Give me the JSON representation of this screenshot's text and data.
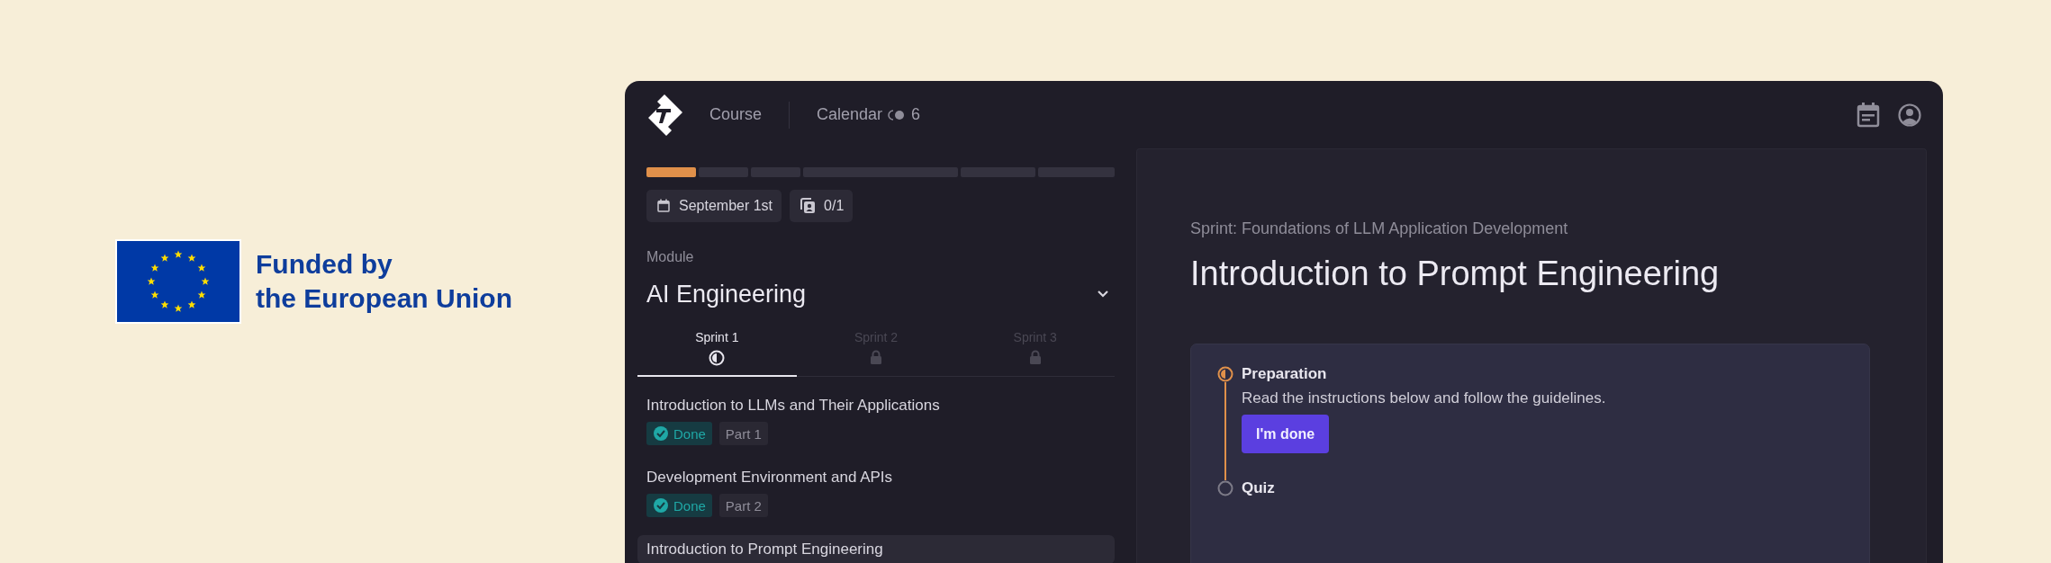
{
  "funding_logo": {
    "line_1": "Funded by",
    "line_2": "the European Union"
  },
  "header": {
    "nav": [
      {
        "label": "Course",
        "kind": "link"
      },
      {
        "label": "Calendar",
        "kind": "toggle",
        "count": "6"
      }
    ]
  },
  "progress_segments": [
    {
      "complete": true
    },
    {
      "complete": false
    },
    {
      "complete": false
    },
    {
      "complete": false
    },
    {
      "complete": false
    },
    {
      "complete": false
    }
  ],
  "chips": [
    {
      "kind": "date",
      "label": "September 1st"
    },
    {
      "kind": "assignments",
      "label": "0/1"
    }
  ],
  "module": {
    "label": "Module",
    "value": "AI Engineering"
  },
  "sprint_tabs": [
    {
      "label": "Sprint 1",
      "selected": true,
      "locked": false
    },
    {
      "label": "Sprint 2",
      "selected": false,
      "locked": true
    },
    {
      "label": "Sprint 3",
      "selected": false,
      "locked": true
    }
  ],
  "lessons": [
    {
      "title": "Introduction to LLMs and Their Applications",
      "status": "Done",
      "part": "Part 1",
      "selected": false
    },
    {
      "title": "Development Environment and APIs",
      "status": "Done",
      "part": "Part 2",
      "selected": false
    },
    {
      "title": "Introduction to Prompt Engineering",
      "selected": true
    }
  ],
  "content": {
    "breadcrumb": "Sprint: Foundations of LLM Application Development",
    "title": "Introduction to Prompt Engineering",
    "steps": [
      {
        "title": "Preparation",
        "current": true,
        "description": "Read the instructions below and follow the guidelines.",
        "button": "I'm done"
      },
      {
        "title": "Quiz",
        "current": false
      }
    ]
  }
}
